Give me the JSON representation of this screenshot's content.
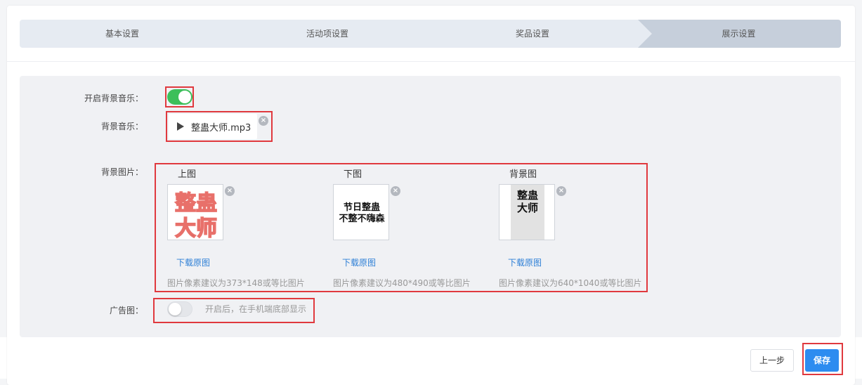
{
  "steps": [
    "基本设置",
    "活动项设置",
    "奖品设置",
    "展示设置"
  ],
  "form": {
    "music_toggle_label": "开启背景音乐：",
    "music_label": "背景音乐：",
    "music_file": "整蛊大师.mp3",
    "images_label": "背景图片：",
    "ad_label": "广告图：",
    "ad_hint": "开启后，在手机端底部显示"
  },
  "images": [
    {
      "title": "上图",
      "download": "下载原图",
      "hint": "图片像素建议为373*148或等比图片",
      "art_line1": "整蛊",
      "art_line2": "大师"
    },
    {
      "title": "下图",
      "download": "下载原图",
      "hint": "图片像素建议为480*490或等比图片",
      "art_line1": "节日整蛊",
      "art_line2": "不整不嗨森"
    },
    {
      "title": "背景图",
      "download": "下载原图",
      "hint": "图片像素建议为640*1040或等比图片",
      "art_line1": "整蛊",
      "art_line2": "大师"
    }
  ],
  "close_glyph": "×",
  "buttons": {
    "prev": "上一步",
    "save": "保存"
  },
  "colors": {
    "accent": "#2d8cf0",
    "toggle_on": "#3cbf5a",
    "highlight": "#e0393e",
    "link": "#2d7fd6"
  }
}
